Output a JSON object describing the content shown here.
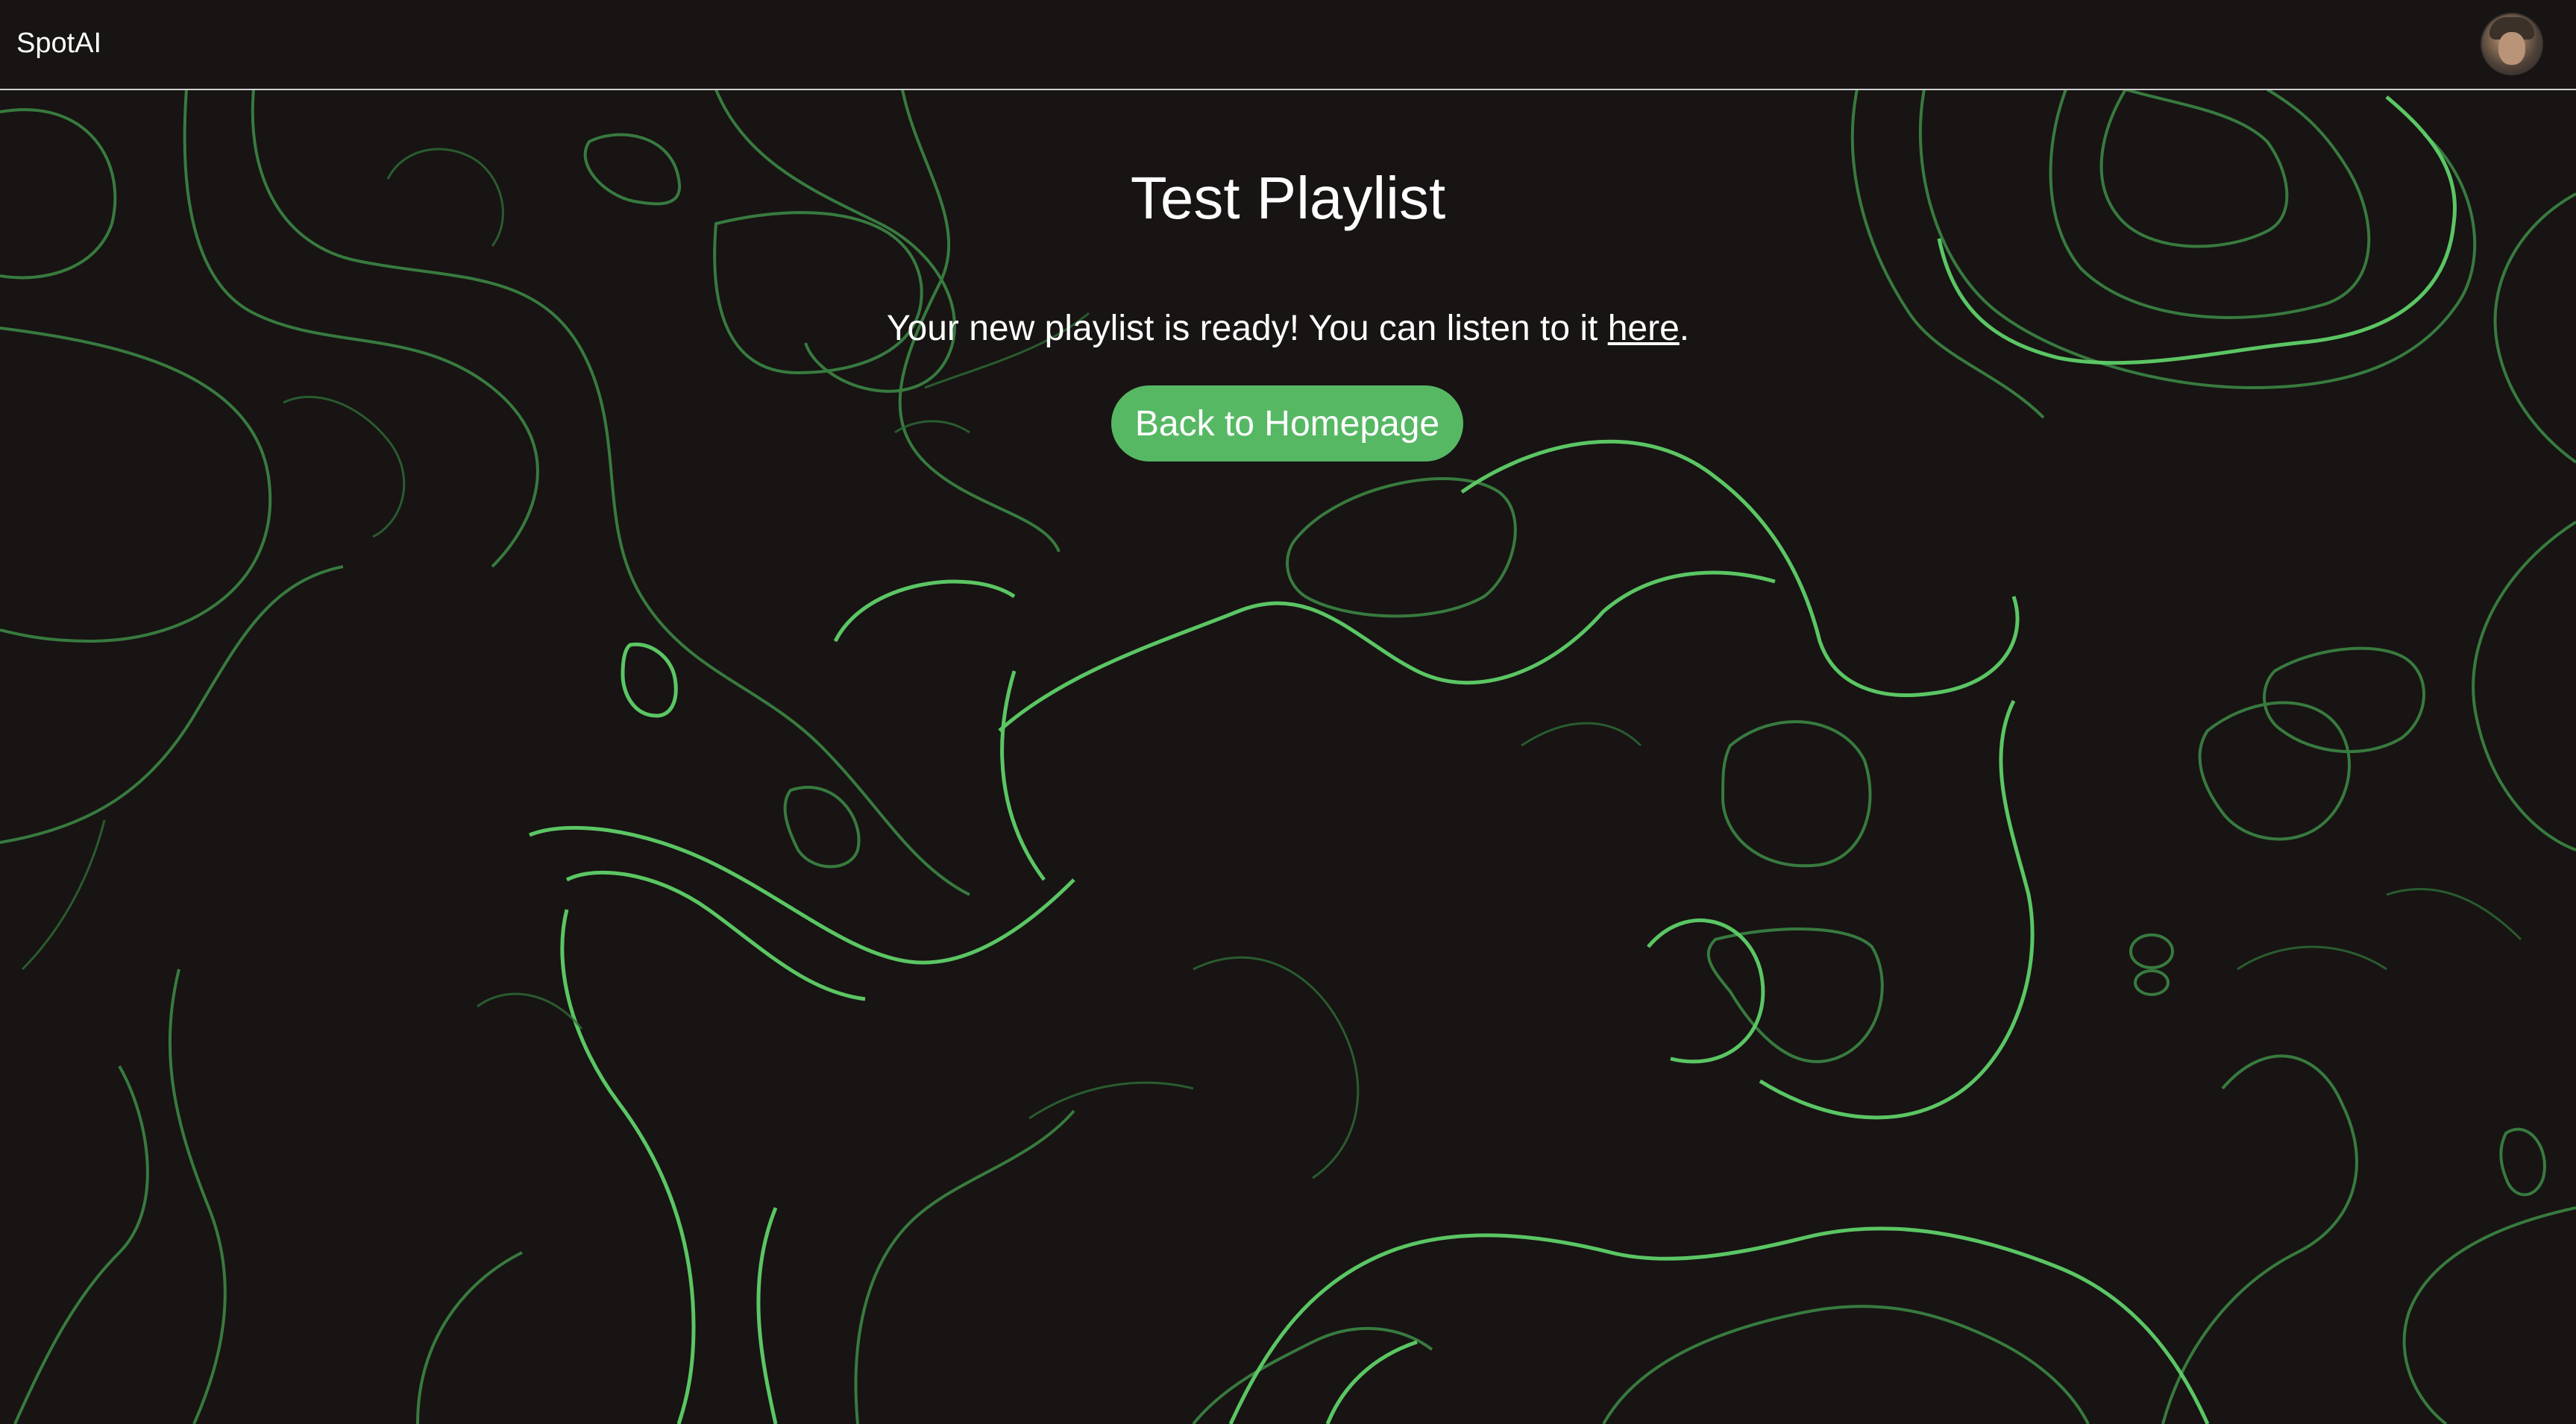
{
  "app": {
    "brand": "SpotAI",
    "avatar_icon": "user-avatar"
  },
  "playlist": {
    "title": "Test Playlist",
    "message_prefix": "Your new playlist is ready! You can listen to it ",
    "link_text": "here",
    "message_suffix": ".",
    "button_label": "Back to Homepage"
  },
  "theme": {
    "background": "#171413",
    "accent": "#57b864",
    "contour_bright": "#5fd068",
    "contour_dim": "#3e8c47"
  }
}
